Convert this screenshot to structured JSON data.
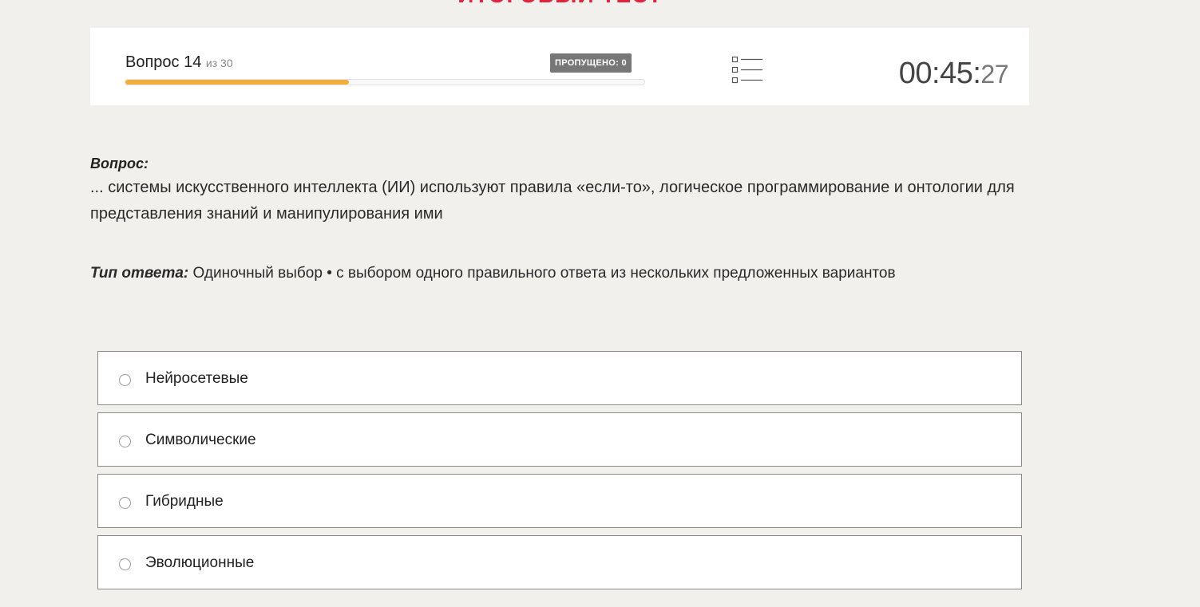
{
  "header": {
    "title": "ИТОГОВЫЙ ТЕСТ",
    "title_color": "#e0243f"
  },
  "status": {
    "question_label": "Вопрос 14",
    "question_total": "из 30",
    "current_question": 14,
    "total_questions": 30,
    "progress_fraction": 0.43,
    "progress_color": "#f0ae3d",
    "skipped_label": "ПРОПУЩЕНО: 0",
    "list_icon": "question-list-icon",
    "timer_main": "00:45:",
    "timer_seconds": "27"
  },
  "question": {
    "label": "Вопрос:",
    "text": "... системы искусственного интеллекта (ИИ) используют правила «если-то», логическое программирование и онтологии для представления знаний и манипулирования ими"
  },
  "answer_type": {
    "label": "Тип ответа:",
    "value": "Одиночный выбор • с выбором одного правильного ответа из нескольких предложенных вариантов"
  },
  "options": [
    {
      "label": "Нейросетевые",
      "selected": false
    },
    {
      "label": "Символические",
      "selected": false
    },
    {
      "label": "Гибридные",
      "selected": false
    },
    {
      "label": "Эволюционные",
      "selected": false
    }
  ]
}
